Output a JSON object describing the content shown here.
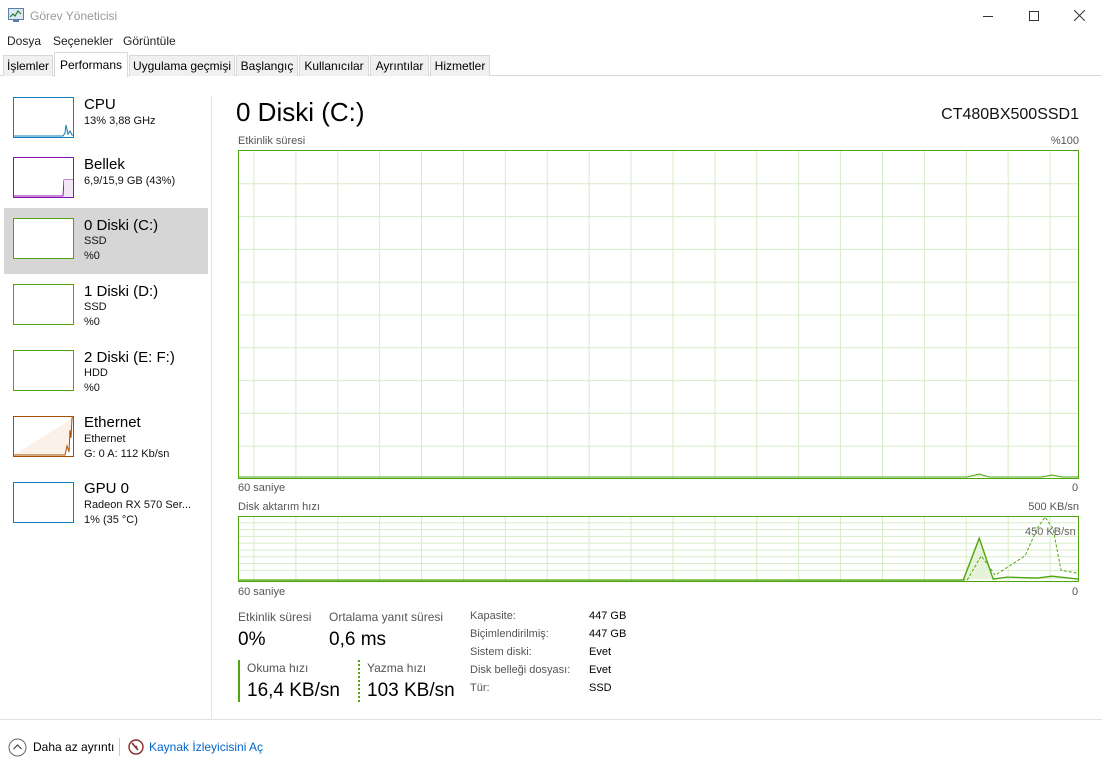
{
  "window": {
    "title": "Görev Yöneticisi"
  },
  "menu": [
    "Dosya",
    "Seçenekler",
    "Görüntüle"
  ],
  "tabs": [
    "İşlemler",
    "Performans",
    "Uygulama geçmişi",
    "Başlangıç",
    "Kullanıcılar",
    "Ayrıntılar",
    "Hizmetler"
  ],
  "active_tab": "Performans",
  "sidebar": [
    {
      "title": "CPU",
      "line1": "13% 3,88 GHz",
      "line2": "",
      "line3": "",
      "color": "#117dbb"
    },
    {
      "title": "Bellek",
      "line1": "6,9/15,9 GB (43%)",
      "line2": "",
      "line3": "",
      "color": "#8b12ae"
    },
    {
      "title": "0 Diski (C:)",
      "line1": "SSD",
      "line2": "%0",
      "line3": "",
      "color": "#4da60c"
    },
    {
      "title": "1 Diski (D:)",
      "line1": "SSD",
      "line2": "%0",
      "line3": "",
      "color": "#4da60c"
    },
    {
      "title": "2 Diski (E: F:)",
      "line1": "HDD",
      "line2": "%0",
      "line3": "",
      "color": "#4da60c"
    },
    {
      "title": "Ethernet",
      "line1": "Ethernet",
      "line2": "G: 0  A: 112 Kb/sn",
      "line3": "",
      "color": "#a74f01"
    },
    {
      "title": "GPU 0",
      "line1": "Radeon RX 570 Ser...",
      "line2": "1% (35 °C)",
      "line3": "",
      "color": "#117dbb"
    }
  ],
  "main": {
    "title": "0 Diski (C:)",
    "model": "CT480BX500SSD1",
    "graph1": {
      "label": "Etkinlik süresi",
      "max_label": "%100",
      "time_label": "60 saniye",
      "min_label": "0"
    },
    "graph2": {
      "label": "Disk aktarım hızı",
      "max_label": "500 KB/sn",
      "mid_label": "450 KB/sn",
      "time_label": "60 saniye",
      "min_label": "0"
    },
    "stats": {
      "activity_label": "Etkinlik süresi",
      "activity_value": "0%",
      "response_label": "Ortalama yanıt süresi",
      "response_value": "0,6 ms",
      "read_label": "Okuma hızı",
      "read_value": "16,4 KB/sn",
      "write_label": "Yazma hızı",
      "write_value": "103 KB/sn"
    },
    "properties": [
      {
        "label": "Kapasite:",
        "value": "447 GB"
      },
      {
        "label": "Biçimlendirilmiş:",
        "value": "447 GB"
      },
      {
        "label": "Sistem diski:",
        "value": "Evet"
      },
      {
        "label": "Disk belleği dosyası:",
        "value": "Evet"
      },
      {
        "label": "Tür:",
        "value": "SSD"
      }
    ]
  },
  "footer": {
    "less_details": "Daha az ayrıntı",
    "resource_monitor": "Kaynak İzleyicisini Aç"
  },
  "colors": {
    "disk_green": "#4da60c",
    "link_blue": "#0066cc"
  }
}
